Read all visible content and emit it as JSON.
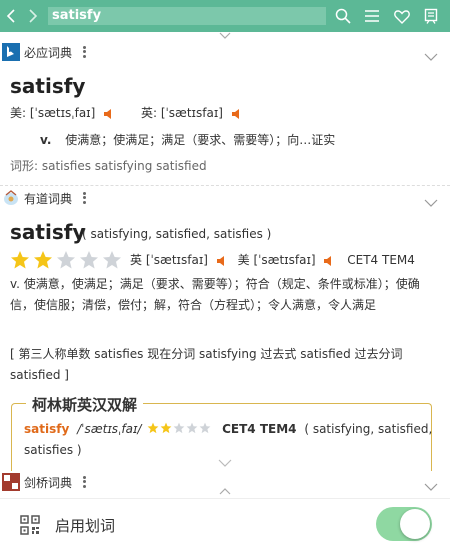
{
  "topbar": {
    "search_value": "satisfy"
  },
  "bing": {
    "name": "必应词典",
    "word": "satisfy",
    "us_label": "美: [ˈsætɪsˌfaɪ]",
    "uk_label": "英: [ˈsætɪsfaɪ]",
    "pos": "v.",
    "definition": "使满意；使满足；满足（要求、需要等）；向…证实",
    "forms": "词形: satisfies   satisfying   satisfied"
  },
  "youdao": {
    "name": "有道词典",
    "word": "satisfy",
    "inflections": "( satisfying, satisfied, satisfies )",
    "rating": 2,
    "rating_max": 5,
    "uk_phon": "英 [ˈsætɪsfaɪ]",
    "us_phon": "美 [ˈsætɪsfaɪ]",
    "tags": "CET4 TEM4",
    "definition": "v. 使满意，使满足；满足（要求、需要等）；符合（规定、条件或标准）；使确信，使信服；清偿，偿付；解，符合（方程式）；令人满意，令人满足",
    "grammar": "[ 第三人称单数 satisfies 现在分词 satisfying 过去式 satisfied 过去分词 satisfied ]"
  },
  "collins": {
    "title": "柯林斯英汉双解",
    "word": "satisfy",
    "phon": "/ˈsætɪsˌfaɪ/",
    "rating": 2,
    "rating_max": 5,
    "tags": "CET4 TEM4",
    "inflections": "( satisfying, satisfied, satisfies )"
  },
  "cambridge": {
    "name": "剑桥词典"
  },
  "bottom": {
    "toggle_label": "启用划词",
    "toggle_on": true
  },
  "colors": {
    "topbar": "#5cb896",
    "accent": "#e06a1a",
    "star": "#f5c518",
    "toggle": "#8fd8a2"
  }
}
